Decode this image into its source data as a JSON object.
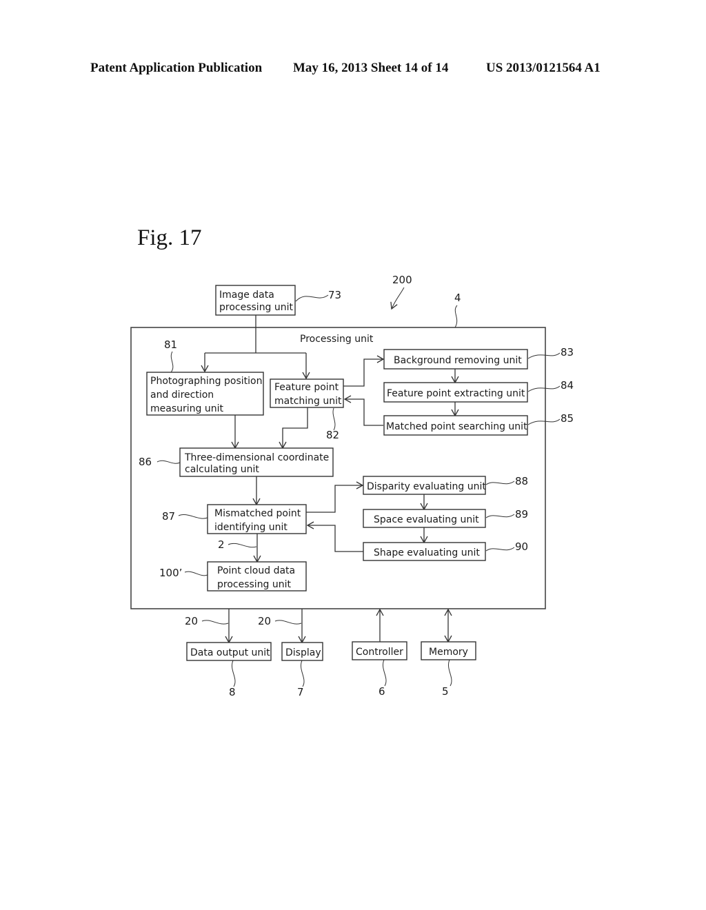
{
  "header": {
    "publication": "Patent Application Publication",
    "date_sheet": "May 16, 2013  Sheet 14 of 14",
    "number": "US 2013/0121564 A1"
  },
  "figure": {
    "title": "Fig. 17",
    "system_ref": "200",
    "processing_unit": {
      "label": "Processing unit",
      "ref": "4"
    },
    "boxes": {
      "image_data": {
        "lines": [
          "Image data",
          "processing unit"
        ],
        "ref": "73"
      },
      "photographing": {
        "lines": [
          "Photographing position",
          "and direction",
          "measuring  unit"
        ],
        "ref": "81"
      },
      "feature_matching": {
        "lines": [
          "Feature point",
          "matching unit"
        ],
        "ref": "82"
      },
      "background": {
        "lines": [
          "Background removing unit"
        ],
        "ref": "83"
      },
      "feature_extracting": {
        "lines": [
          "Feature point extracting unit"
        ],
        "ref": "84"
      },
      "matched_searching": {
        "lines": [
          "Matched point searching unit"
        ],
        "ref": "85"
      },
      "three_d": {
        "lines": [
          "Three-dimensional coordinate",
          "calculating unit"
        ],
        "ref": "86"
      },
      "mismatched": {
        "lines": [
          "Mismatched point",
          "identifying unit"
        ],
        "ref": "87"
      },
      "disparity": {
        "lines": [
          "Disparity evaluating unit"
        ],
        "ref": "88"
      },
      "space": {
        "lines": [
          "Space evaluating unit"
        ],
        "ref": "89"
      },
      "shape": {
        "lines": [
          "Shape evaluating unit"
        ],
        "ref": "90"
      },
      "point_cloud": {
        "lines": [
          "Point cloud data",
          "processing unit"
        ],
        "ref": "100’"
      },
      "data_output": {
        "lines": [
          "Data output unit"
        ],
        "ref": "8"
      },
      "display": {
        "lines": [
          "Display"
        ],
        "ref": "7"
      },
      "controller": {
        "lines": [
          "Controller"
        ],
        "ref": "6"
      },
      "memory": {
        "lines": [
          "Memory"
        ],
        "ref": "5"
      }
    },
    "connector_refs": {
      "mismatched_to_pointcloud": "2",
      "bus_to_data_output": "20",
      "bus_to_display": "20"
    }
  }
}
